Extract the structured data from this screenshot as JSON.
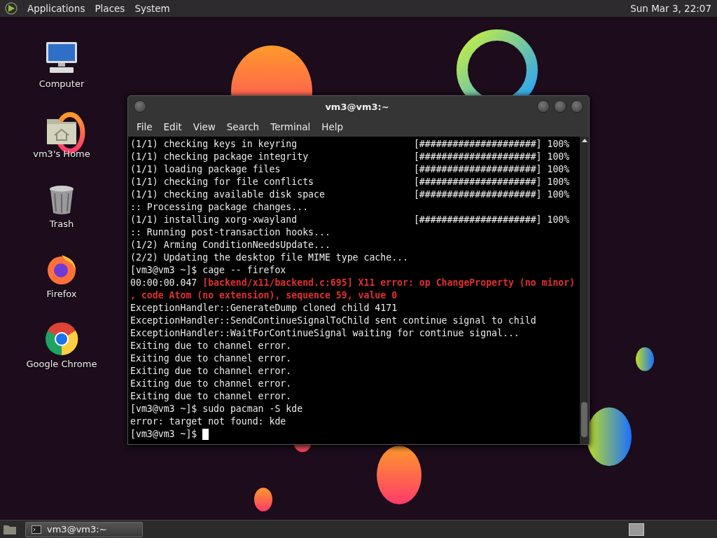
{
  "top_panel": {
    "menus": [
      "Applications",
      "Places",
      "System"
    ],
    "clock": "Sun Mar 3, 22:07"
  },
  "desktop_icons": [
    {
      "label": "Computer",
      "kind": "computer"
    },
    {
      "label": "vm3's Home",
      "kind": "home"
    },
    {
      "label": "Trash",
      "kind": "trash"
    },
    {
      "label": "Firefox",
      "kind": "firefox"
    },
    {
      "label": "Google Chrome",
      "kind": "chrome"
    }
  ],
  "terminal": {
    "title": "vm3@vm3:~",
    "menu": [
      "File",
      "Edit",
      "View",
      "Search",
      "Terminal",
      "Help"
    ],
    "lines": [
      {
        "kind": "progress",
        "text": "(1/1) checking keys in keyring",
        "bar": "[#####################]",
        "percent": "100%"
      },
      {
        "kind": "progress",
        "text": "(1/1) checking package integrity",
        "bar": "[#####################]",
        "percent": "100%"
      },
      {
        "kind": "progress",
        "text": "(1/1) loading package files",
        "bar": "[#####################]",
        "percent": "100%"
      },
      {
        "kind": "progress",
        "text": "(1/1) checking for file conflicts",
        "bar": "[#####################]",
        "percent": "100%"
      },
      {
        "kind": "progress",
        "text": "(1/1) checking available disk space",
        "bar": "[#####################]",
        "percent": "100%"
      },
      {
        "kind": "plain",
        "text": ":: Processing package changes..."
      },
      {
        "kind": "progress",
        "text": "(1/1) installing xorg-xwayland",
        "bar": "[#####################]",
        "percent": "100%"
      },
      {
        "kind": "plain",
        "text": ":: Running post-transaction hooks..."
      },
      {
        "kind": "plain",
        "text": "(1/2) Arming ConditionNeedsUpdate..."
      },
      {
        "kind": "plain",
        "text": "(2/2) Updating the desktop file MIME type cache..."
      },
      {
        "kind": "plain",
        "text": "[vm3@vm3 ~]$ cage -- firefox"
      },
      {
        "kind": "mixed",
        "text": "00:00:00.047 **[backend/x11/backend.c:695] X11 error: op ChangeProperty (no minor)**"
      },
      {
        "kind": "error",
        "text": ", code Atom (no extension), sequence 59, value 0"
      },
      {
        "kind": "plain",
        "text": "ExceptionHandler::GenerateDump cloned child 4171"
      },
      {
        "kind": "plain",
        "text": "ExceptionHandler::SendContinueSignalToChild sent continue signal to child"
      },
      {
        "kind": "plain",
        "text": "ExceptionHandler::WaitForContinueSignal waiting for continue signal..."
      },
      {
        "kind": "plain",
        "text": "Exiting due to channel error."
      },
      {
        "kind": "plain",
        "text": "Exiting due to channel error."
      },
      {
        "kind": "plain",
        "text": "Exiting due to channel error."
      },
      {
        "kind": "plain",
        "text": "Exiting due to channel error."
      },
      {
        "kind": "plain",
        "text": "Exiting due to channel error."
      },
      {
        "kind": "plain",
        "text": "[vm3@vm3 ~]$ sudo pacman -S kde"
      },
      {
        "kind": "plain",
        "text": "error: target not found: kde"
      },
      {
        "kind": "prompt",
        "text": "[vm3@vm3 ~]$"
      }
    ]
  },
  "taskbar": {
    "tasks": [
      {
        "label": "vm3@vm3:~"
      }
    ]
  }
}
